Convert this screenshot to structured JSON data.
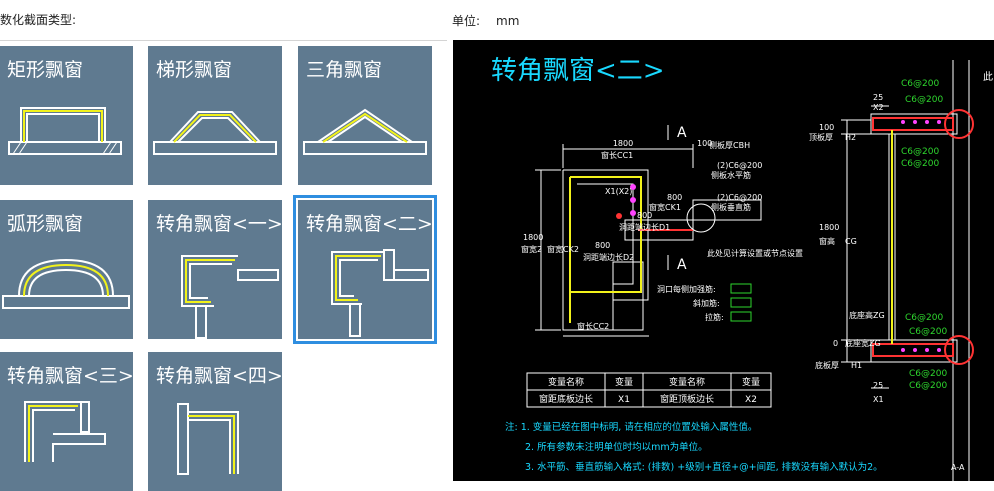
{
  "header": {
    "section_type_label": "数化截面类型:",
    "unit_label": "单位:",
    "unit_value": "mm"
  },
  "gallery": {
    "tiles": [
      {
        "label": "矩形飘窗",
        "icon": "rect-bay-window-icon",
        "selected": false
      },
      {
        "label": "梯形飘窗",
        "icon": "trapezoid-bay-window-icon",
        "selected": false
      },
      {
        "label": "三角飘窗",
        "icon": "triangle-bay-window-icon",
        "selected": false
      },
      {
        "label": "弧形飘窗",
        "icon": "arc-bay-window-icon",
        "selected": false
      },
      {
        "label": "转角飘窗<一>",
        "icon": "corner-bay-window-1-icon",
        "selected": false
      },
      {
        "label": "转角飘窗<二>",
        "icon": "corner-bay-window-2-icon",
        "selected": true
      },
      {
        "label": "转角飘窗<三>",
        "icon": "corner-bay-window-3-icon",
        "selected": false
      },
      {
        "label": "转角飘窗<四>",
        "icon": "corner-bay-window-4-icon",
        "selected": false
      }
    ]
  },
  "drawing": {
    "title": "转角飘窗<二>",
    "section_marker": "A",
    "dims": {
      "d1800_top": "1800",
      "d100_top": "100",
      "d1800_left": "1800",
      "d800_a": "800",
      "d800_b": "800",
      "d800_c": "800",
      "d100_right": "100",
      "d1800_right": "1800",
      "d0_right": "0",
      "d25_top": "25",
      "d25_bottom": "25"
    },
    "labels": {
      "cc1": "窗长CC1",
      "cbh": "侧板厚CBH",
      "x1x2": "X1(X2)",
      "rebar_c6_1": "(2)C6@200",
      "side_horiz": "侧板水平筋",
      "rebar_c6_2": "(2)C6@200",
      "side_vert": "侧板垂直筋",
      "ck1": "窗宽CK1",
      "d1": "洞距端边长D1",
      "d2": "洞距端边长D2",
      "ck2": "窗宽CK2",
      "kuan2": "窗宽2",
      "note_calc": "此处见计算设置或节点设置",
      "hole_add": "洞口每侧加强筋:",
      "diag": "斜加筋:",
      "tie": "拉筋:",
      "cc2": "窗长CC2",
      "x2": "X2",
      "top_thk": "顶板厚",
      "h2": "H2",
      "cg": "窗高",
      "cg_code": "CG",
      "bottom_thk": "底板厚",
      "h1": "H1",
      "zgsg": "底座高ZG",
      "zgsg2": "底座宽ZG",
      "x1": "X1",
      "aa": "A-A",
      "ci": "此"
    },
    "rebars_right": [
      "C6@200",
      "C6@200",
      "C6@200",
      "C6@200",
      "C6@200",
      "C6@200",
      "C6@200",
      "C6@200"
    ],
    "table": {
      "headers": [
        "变量名称",
        "变量",
        "变量名称",
        "变量"
      ],
      "row": [
        "窗距底板边长",
        "X1",
        "窗距顶板边长",
        "X2"
      ]
    },
    "notes": [
      "注: 1. 变量已经在图中标明, 请在相应的位置处输入属性值。",
      "2. 所有参数未注明单位时均以mm为单位。",
      "3. 水平筋、垂直筋输入格式: (排数) +级别+直径+@+间距, 排数没有输入默认为2。"
    ]
  }
}
